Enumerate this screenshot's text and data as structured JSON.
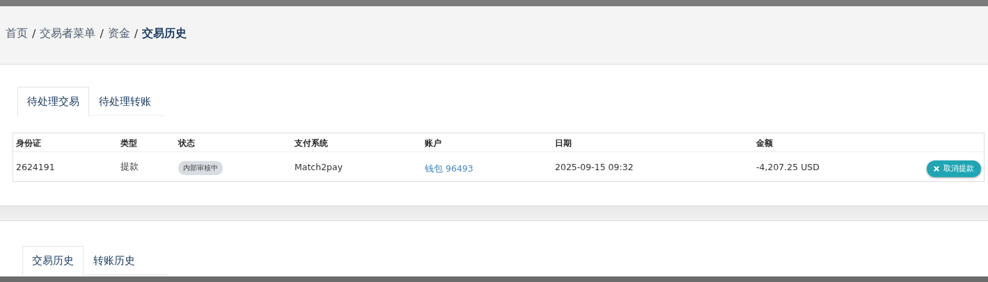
{
  "breadcrumb": [
    {
      "label": "首页",
      "current": false
    },
    {
      "label": "交易者菜单",
      "current": false
    },
    {
      "label": "资金",
      "current": false
    },
    {
      "label": "交易历史",
      "current": true
    }
  ],
  "breadcrumb_separator": "/",
  "pending": {
    "tabs": [
      {
        "label": "待处理交易",
        "selected": true
      },
      {
        "label": "待处理转账",
        "selected": false
      }
    ],
    "table": {
      "columns": [
        "身份证",
        "类型",
        "状态",
        "支付系统",
        "账户",
        "日期",
        "金额"
      ],
      "rows": [
        {
          "cells": [
            {
              "kind": "text",
              "text": "2624191"
            },
            {
              "kind": "text",
              "text": "提款"
            },
            {
              "kind": "badge",
              "text": "内部审核中"
            },
            {
              "kind": "text",
              "text": "Match2pay"
            },
            {
              "kind": "link",
              "text": "钱包 96493"
            },
            {
              "kind": "text",
              "text": "2025-09-15 09:32"
            },
            {
              "kind": "text",
              "text": "-4,207.25 USD"
            }
          ],
          "action": "取消提款"
        }
      ]
    }
  },
  "history": {
    "tabs": [
      {
        "label": "交易历史",
        "selected": true
      },
      {
        "label": "转账历史",
        "selected": false
      }
    ]
  }
}
